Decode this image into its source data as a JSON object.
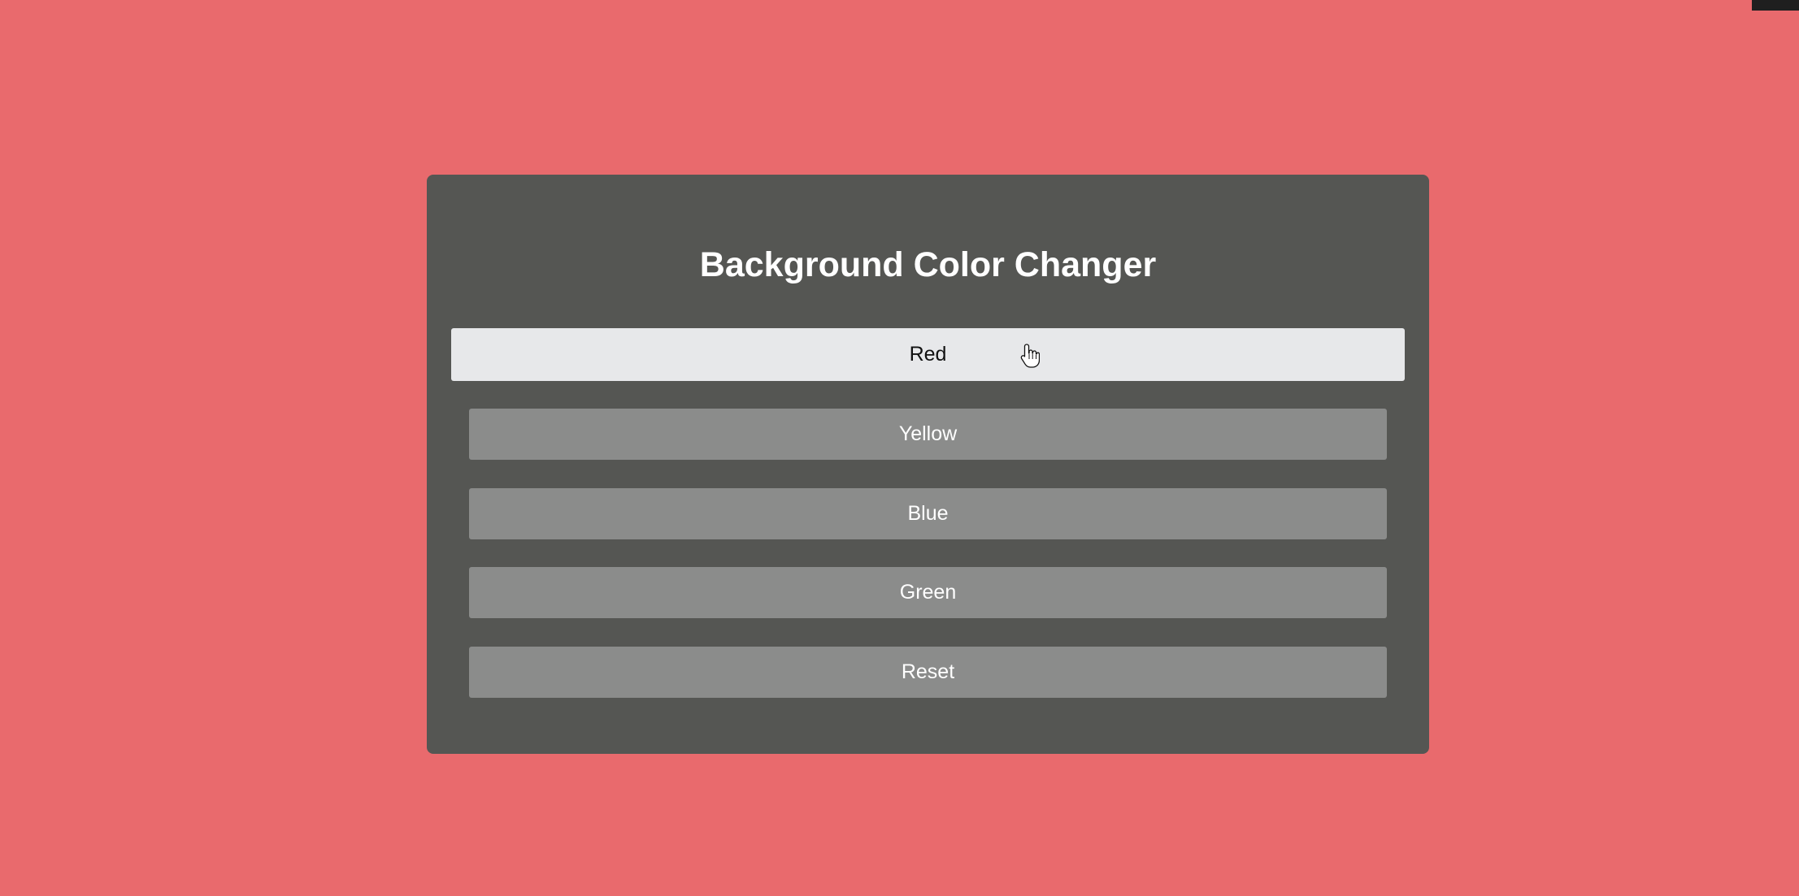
{
  "colors": {
    "page_background": "#e96a6d",
    "panel_background": "#555653",
    "button_default": "#8b8c8b",
    "button_default_text": "#ffffff",
    "button_hover": "#e7e8ea",
    "button_hover_text": "#111111"
  },
  "app": {
    "title": "Background Color Changer"
  },
  "buttons": [
    {
      "label": "Red",
      "state": "hover"
    },
    {
      "label": "Yellow",
      "state": "default"
    },
    {
      "label": "Blue",
      "state": "default"
    },
    {
      "label": "Green",
      "state": "default"
    },
    {
      "label": "Reset",
      "state": "default"
    }
  ],
  "cursor": {
    "icon": "hand-pointer-icon"
  }
}
